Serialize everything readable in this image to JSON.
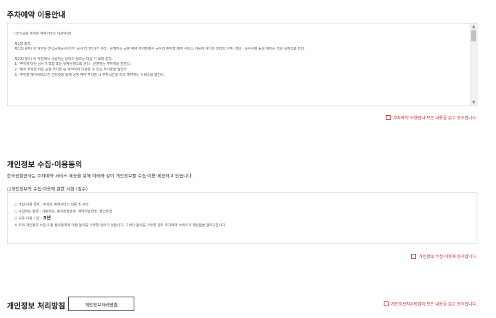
{
  "section1": {
    "title": "주차예약 이용안내",
    "terms_lines": [
      "(한국공항 주차장 예약서비스 이용약관)",
      "",
      "제1장 총칙",
      "제1조(목적) 이 약관은 한국공항공사(이하 '공사'라 한다)가 관리 · 운영하는 공항 예약 주차장에서 공사와 주차장 예약 서비스 이용자 사이의 권리와 의무, 책임 · 준수사항 등을 정하는 것을 목적으로 한다.",
      "",
      "제2조(정의) 이 약관에서 사용하는 용어의 정의는 다음 각 호와 같다.",
      "1. '주차장'이란 공사가 직접 또는 위탁운영으로 관리 · 운영하는 주차장을 말한다.",
      "2. '예약 주차장'이란 공항 주차장 중 예약하여 이용할 수 있는 주차장을 말한다.",
      "3. '주차장 예약서비스'란 인터넷을 통해 공항 예약 주차장 내 주차공간을 미리 예약하는 서비스를 말한다."
    ],
    "agree_label": "주차예약 이용안내 모든 내용을 읽고 동의합니다."
  },
  "section2": {
    "title": "개인정보 수집·이용동의",
    "intro": "한국공항공사는 주차예약 서비스 제공을 위해 아래와 같이 개인정보를 수집·이용·제공하고 있습니다.",
    "sub_title": "□개인정보의 수집·이용에 관한 사항 (필수)",
    "items": [
      "○ 수집·이용 목적 : 주차장 예약서비스 이용 및 관리",
      "○ 수집하는 항목 : 차량번호, 휴대전화번호, 예약비밀번호, 할인유형"
    ],
    "retention_label": "○ 보유·이용 기간 : ",
    "retention_value": "3년",
    "notice": "※ 위의 개인정보 수집·이용 필수항목에 대한 동의를 거부할 권리가 있습니다. 그러나 동의를 거부할 경우 주차예약 서비스가 제한됨을 알려드립니다.",
    "agree_label": "개인정보 수집·이용에 동의합니다."
  },
  "section3": {
    "title": "개인정보 처리방침",
    "button_label": "개인정보처리방침",
    "agree_label": "개인정보처리방침의 모든 내용을 읽고 동의합니다."
  },
  "colors": {
    "accent_red": "#d0312d",
    "border": "#d9d9d9"
  }
}
